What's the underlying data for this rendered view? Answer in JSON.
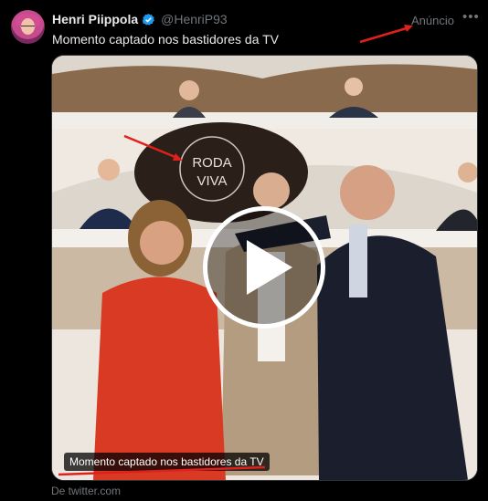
{
  "author": {
    "name": "Henri Piippola",
    "handle": "@HenriP93",
    "verified": true
  },
  "ad_label": "Anúncio",
  "more_icon": "more-horizontal-icon",
  "tweet_text": "Momento captado nos bastidores da TV",
  "media": {
    "caption": "Momento captado nos bastidores da TV",
    "logo_line1": "RODA",
    "logo_line2": "VIVA",
    "play_icon": "play-icon"
  },
  "source": "De twitter.com",
  "colors": {
    "background": "#000000",
    "verified": "#1d9bf0",
    "secondary_text": "#71767b",
    "annotation_arrow": "#e0201b"
  }
}
